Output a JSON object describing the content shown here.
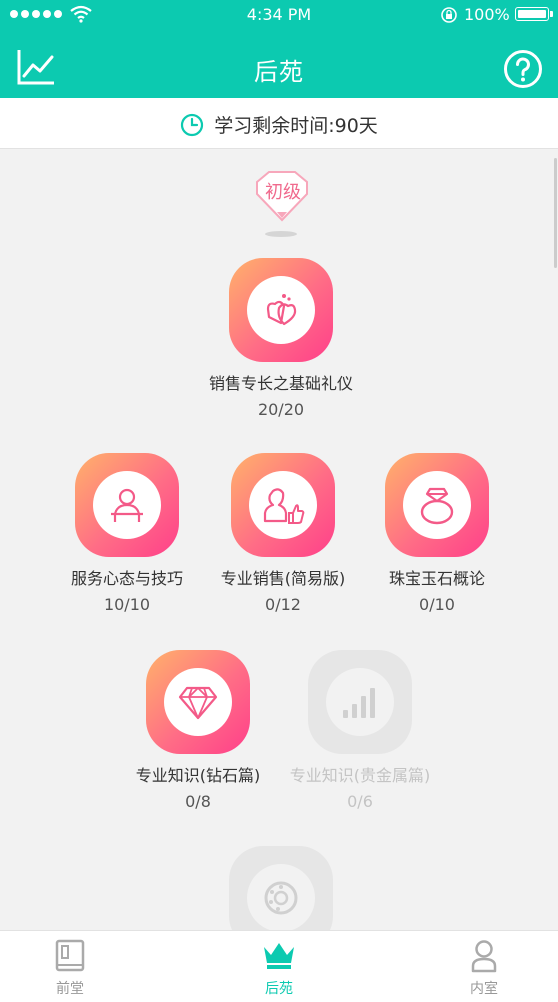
{
  "status_bar": {
    "time": "4:34 PM",
    "battery": "100%"
  },
  "header": {
    "title": "后苑",
    "left_icon": "line-chart-icon",
    "right_icon": "help-icon"
  },
  "study_time": {
    "label": "学习剩余时间:90天",
    "icon": "clock-icon"
  },
  "level": {
    "label": "初级"
  },
  "courses": [
    {
      "name": "销售专长之基础礼仪",
      "progress": "20/20",
      "icon": "hearts-icon",
      "locked": false
    },
    {
      "name": "服务心态与技巧",
      "progress": "10/10",
      "icon": "person-desk-icon",
      "locked": false
    },
    {
      "name": "专业销售(简易版)",
      "progress": "0/12",
      "icon": "person-thumbs-up-icon",
      "locked": false
    },
    {
      "name": "珠宝玉石概论",
      "progress": "0/10",
      "icon": "ring-icon",
      "locked": false
    },
    {
      "name": "专业知识(钻石篇)",
      "progress": "0/8",
      "icon": "diamond-icon",
      "locked": false
    },
    {
      "name": "专业知识(贵金属篇)",
      "progress": "0/6",
      "icon": "signal-bars-icon",
      "locked": true
    },
    {
      "name": "",
      "progress": "",
      "icon": "dial-icon",
      "locked": true
    }
  ],
  "tabs": [
    {
      "label": "前堂",
      "icon": "book-icon",
      "active": false
    },
    {
      "label": "后苑",
      "icon": "crown-icon",
      "active": true
    },
    {
      "label": "内室",
      "icon": "user-icon",
      "active": false
    }
  ],
  "colors": {
    "brand": "#0ccab0",
    "accent_gradient_start": "#ffb26a",
    "accent_gradient_end": "#ff3f8a",
    "locked": "#e6e6e6"
  }
}
